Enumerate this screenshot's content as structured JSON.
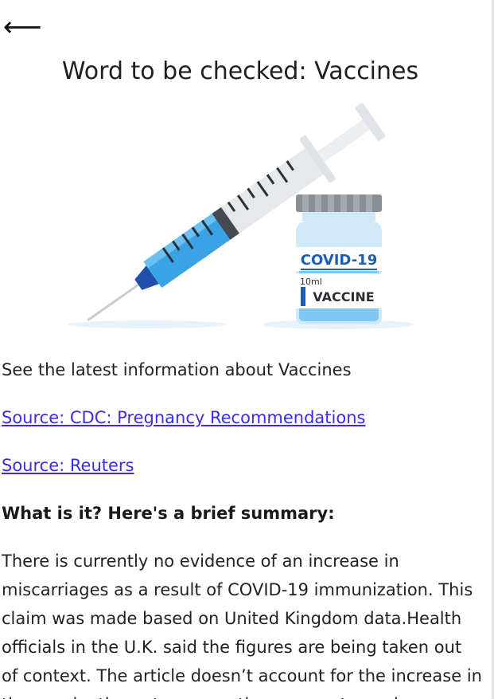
{
  "header": {
    "back_glyph": "⟵",
    "title": "Word to be checked: Vaccines"
  },
  "hero_image": {
    "vial_label_top": "COVID-19",
    "vial_label_volume": "10ml",
    "vial_label_bottom": "VACCINE",
    "colors": {
      "liquid": "#3aa3e6",
      "vial_glass": "#cfe9f8",
      "cap": "#8a8f96",
      "label_blue": "#1b5fb5",
      "needle_hub": "#1f4fa8"
    }
  },
  "content": {
    "intro": "See the latest information about Vaccines",
    "links": [
      "Source: CDC: Pregnancy Recommendations",
      "Source: Reuters"
    ],
    "summary_heading": "What is it? Here's a brief summary:",
    "summary_text": "There is currently no evidence of an increase in miscarriages as a result of COVID-19 immunization. This claim was made based on United Kingdom data.Health officials in the U.K. said the figures are being taken out of context. The article doesn’t account for the increase in the vaccination rate among the pregnant people."
  },
  "colors": {
    "link": "#3b2de0",
    "text": "#222222"
  }
}
